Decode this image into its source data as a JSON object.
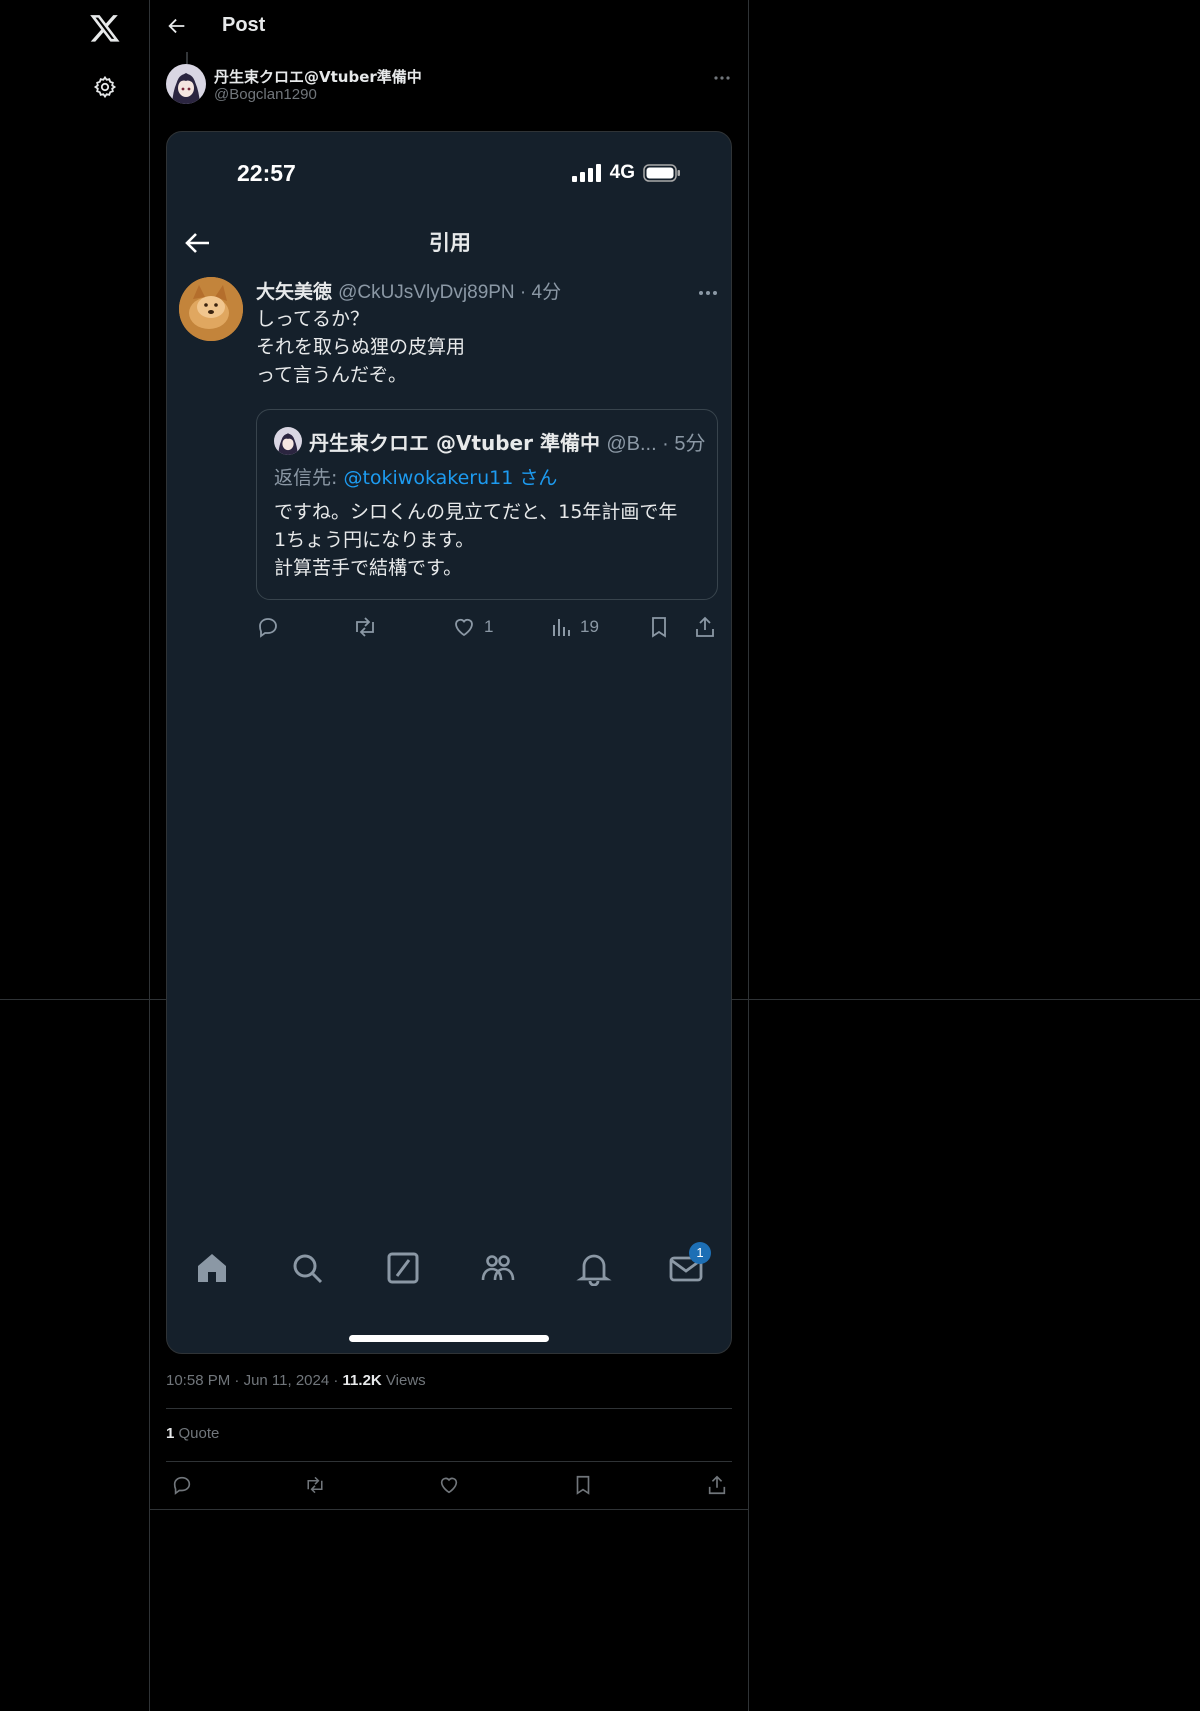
{
  "header": {
    "title": "Post"
  },
  "author": {
    "name": "丹生束クロエ@Vtuber準備中",
    "handle": "@Bogclan1290"
  },
  "screenshot": {
    "status": {
      "time": "22:57",
      "network": "4G"
    },
    "nav_title": "引用",
    "tweet": {
      "name": "大矢美徳",
      "handle_time": "@CkUJsVlyDvj89PN · 4分",
      "lines": [
        "しってるか？",
        "それを取らぬ狸の皮算用",
        "って言うんだぞ。"
      ]
    },
    "quoted": {
      "name": "丹生束クロエ @Vtuber 準備中",
      "handle_time": "@B... · 5分",
      "reply_prefix": "返信先: ",
      "reply_mention": "@tokiwokakeru11 さん",
      "lines": [
        "ですね。シロくんの見立てだと、15年計画で年",
        "1ちょう円になります。",
        "計算苦手で結構です。"
      ]
    },
    "actions": {
      "likes": "1",
      "views": "19"
    },
    "tab_badge": "1"
  },
  "meta": {
    "time": "10:58 PM",
    "date": "Jun 11, 2024",
    "views_count": "11.2K",
    "views_label": "Views"
  },
  "stats": {
    "quote_count": "1",
    "quote_label": "Quote"
  },
  "colors": {
    "background": "#000000",
    "dim_panel": "#15202b",
    "accent": "#1d9bf0",
    "muted": "#71767b"
  }
}
